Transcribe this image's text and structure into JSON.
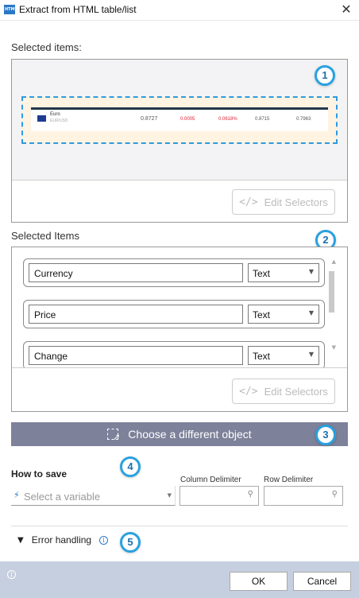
{
  "window": {
    "title": "Extract from HTML table/list",
    "app_icon_text": "HTML",
    "close_glyph": "✕"
  },
  "selected_preview": {
    "label": "Selected items:",
    "badge": "1",
    "row": {
      "name": "Euro",
      "sub": "EUR/USD",
      "values": [
        "0.8727",
        "0.0005",
        "0.0618%",
        "0.8715",
        "0.7963"
      ]
    },
    "edit_selectors_label": "Edit Selectors"
  },
  "selected_items": {
    "label": "Selected Items",
    "badge": "2",
    "fields": [
      {
        "name": "Currency",
        "type": "Text"
      },
      {
        "name": "Price",
        "type": "Text"
      },
      {
        "name": "Change",
        "type": "Text"
      }
    ],
    "edit_selectors_label": "Edit Selectors"
  },
  "choose": {
    "label": "Choose a different object",
    "badge": "3"
  },
  "save": {
    "label": "How to save",
    "badge": "4",
    "variable_placeholder": "Select a variable",
    "column_delimiter_label": "Column Delimiter",
    "row_delimiter_label": "Row Delimiter"
  },
  "error_handling": {
    "label": "Error handling",
    "badge": "5"
  },
  "footer": {
    "ok_label": "OK",
    "cancel_label": "Cancel"
  },
  "icons": {
    "app": "html-app-icon",
    "close": "close-icon",
    "edit_selectors": "code-icon",
    "choose": "select-cursor-icon",
    "variable": "bolt-icon",
    "pin": "pin-icon",
    "info": "info-icon",
    "chevron": "chevron-down-icon"
  },
  "colors": {
    "accent_blue": "#29a1e0",
    "choose_button": "#7d8199",
    "footer": "#c5cfdf",
    "highlight_fill": "#fff3e2"
  }
}
